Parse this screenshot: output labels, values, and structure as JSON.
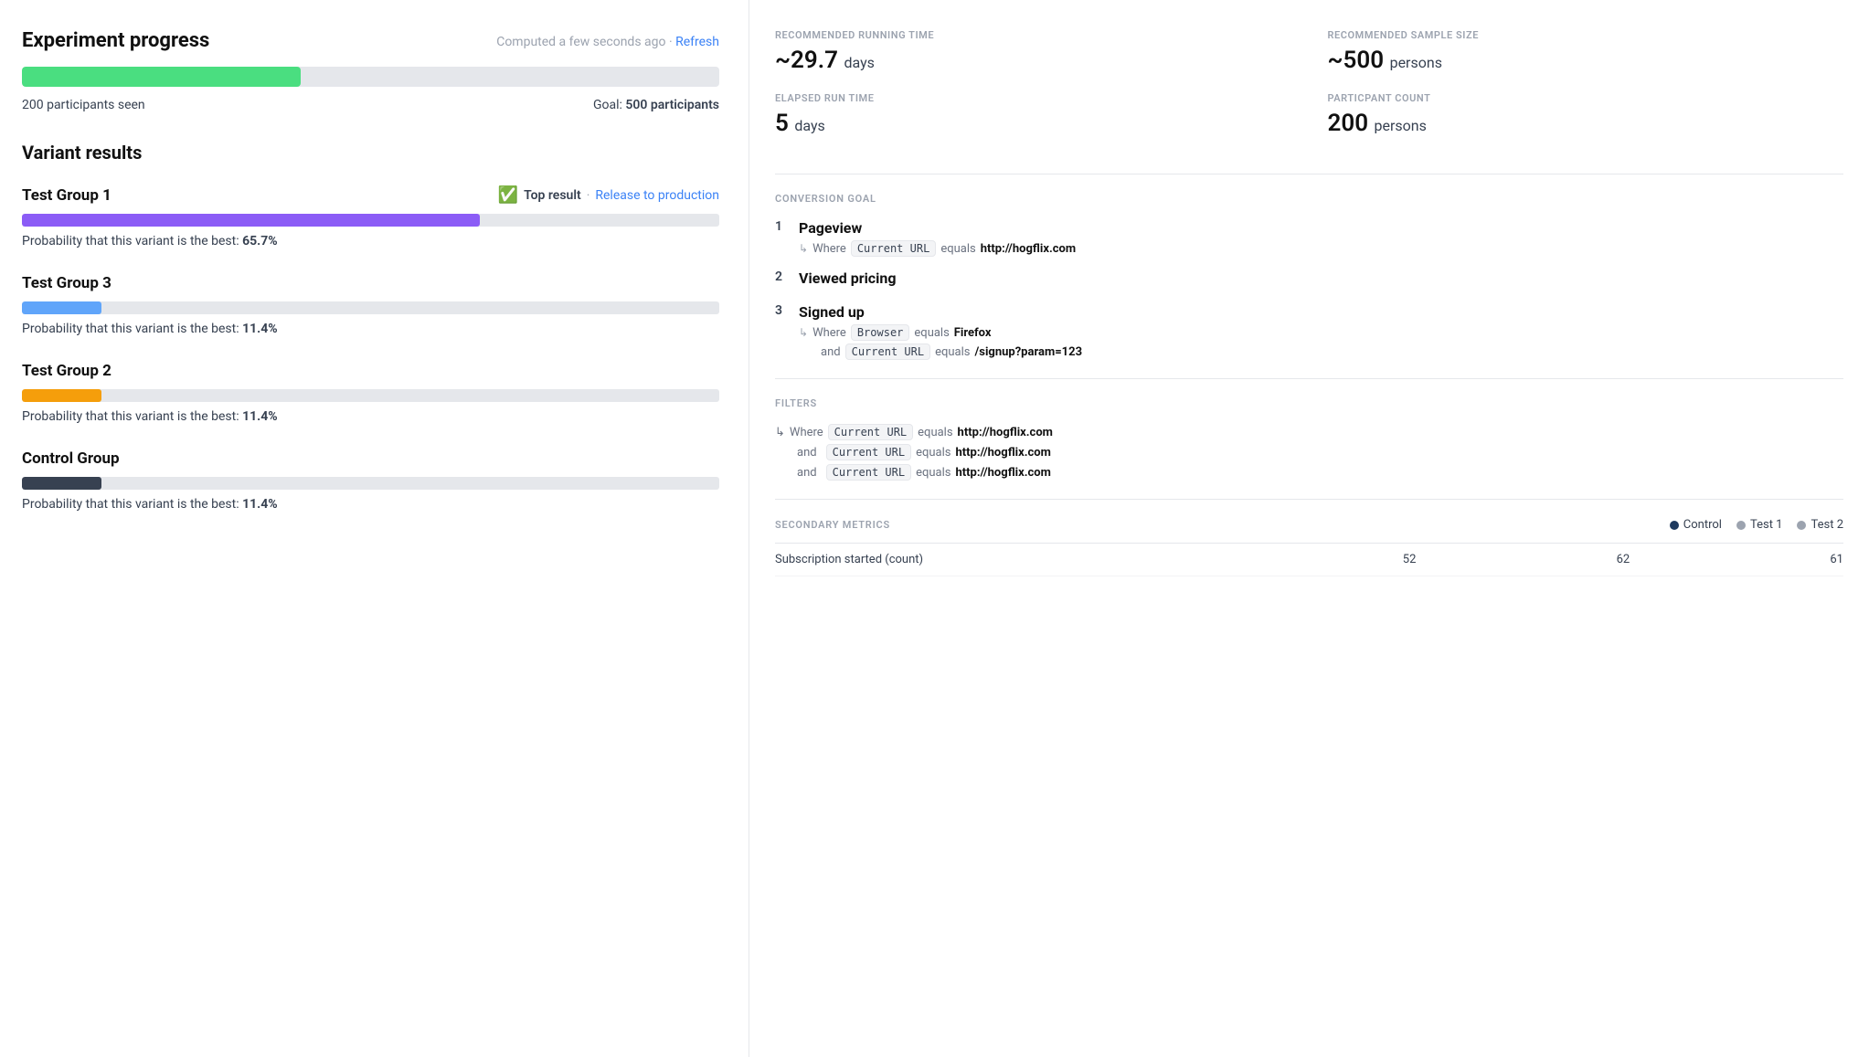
{
  "left": {
    "experiment_title": "Experiment progress",
    "computed_text": "Computed a few seconds ago · ",
    "refresh_label": "Refresh",
    "progress_percent": 40,
    "participants_seen": "200 participants seen",
    "goal_label": "Goal: ",
    "goal_value": "500 participants",
    "variant_results_title": "Variant results",
    "groups": [
      {
        "name": "Test Group 1",
        "is_top": true,
        "top_result_label": "Top result",
        "release_label": "Release to production",
        "bar_color": "#8b5cf6",
        "bar_percent": 65.7,
        "probability_text": "Probability that this variant is the best: ",
        "probability_value": "65.7%"
      },
      {
        "name": "Test Group 3",
        "is_top": false,
        "bar_color": "#60a5fa",
        "bar_percent": 11.4,
        "probability_text": "Probability that this variant is the best: ",
        "probability_value": "11.4%"
      },
      {
        "name": "Test Group 2",
        "is_top": false,
        "bar_color": "#f59e0b",
        "bar_percent": 11.4,
        "probability_text": "Probability that this variant is the best: ",
        "probability_value": "11.4%"
      },
      {
        "name": "Control Group",
        "is_top": false,
        "bar_color": "#374151",
        "bar_percent": 11.4,
        "probability_text": "Probability that this variant is the best: ",
        "probability_value": "11.4%"
      }
    ]
  },
  "right": {
    "rec_run_time_label": "RECOMMENDED RUNNING TIME",
    "rec_run_time_value": "~29.7",
    "rec_run_time_unit": "days",
    "rec_sample_label": "RECOMMENDED SAMPLE SIZE",
    "rec_sample_value": "~500",
    "rec_sample_unit": "persons",
    "elapsed_label": "ELAPSED RUN TIME",
    "elapsed_value": "5",
    "elapsed_unit": "days",
    "participant_label": "PARTICPANT COUNT",
    "participant_value": "200",
    "participant_unit": "persons",
    "conversion_goal_label": "CONVERSION GOAL",
    "goals": [
      {
        "number": "1",
        "name": "Pageview",
        "conditions": [
          {
            "type": "where",
            "arrow": "↳",
            "where": "Where",
            "tag": "Current URL",
            "equals": "equals",
            "value": "http://hogflix.com"
          }
        ]
      },
      {
        "number": "2",
        "name": "Viewed pricing",
        "conditions": []
      },
      {
        "number": "3",
        "name": "Signed up",
        "conditions": [
          {
            "arrow": "↳",
            "where": "Where",
            "tag": "Browser",
            "equals": "equals",
            "value": "Firefox"
          },
          {
            "and": "and",
            "tag": "Current URL",
            "equals": "equals",
            "value": "/signup?param=123"
          }
        ]
      }
    ],
    "filters_label": "FILTERS",
    "filters": [
      {
        "arrow": "↳",
        "where": "Where",
        "tag": "Current URL",
        "equals": "equals",
        "value": "http://hogflix.com"
      },
      {
        "and": "and",
        "tag": "Current URL",
        "equals": "equals",
        "value": "http://hogflix.com"
      },
      {
        "and": "and",
        "tag": "Current URL",
        "equals": "equals",
        "value": "http://hogflix.com"
      }
    ],
    "secondary_metrics_label": "SECONDARY METRICS",
    "legend": [
      {
        "label": "Control",
        "color": "#1e3a5f"
      },
      {
        "label": "Test 1",
        "color": "#9ca3af"
      },
      {
        "label": "Test 2",
        "color": "#9ca3af"
      }
    ],
    "metrics_row_label": "Subscription started (count)",
    "metrics_row_values": [
      "52",
      "62",
      "61"
    ]
  }
}
